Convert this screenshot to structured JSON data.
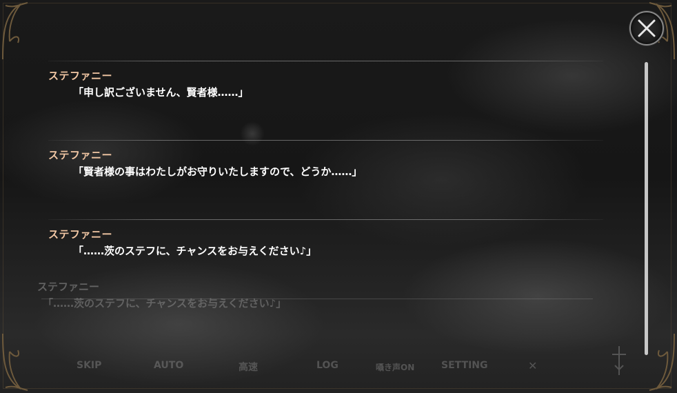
{
  "log_entries": [
    {
      "speaker": "ステファニー",
      "message": "「申し訳ございません、賢者様……」"
    },
    {
      "speaker": "ステファニー",
      "message": "「賢者様の事はわたしがお守りいたしますので、どうか……」"
    },
    {
      "speaker": "ステファニー",
      "message": "「……茨のステフに、チャンスをお与えください♪」"
    }
  ],
  "background_dialogue": {
    "speaker": "ステファニー",
    "message": "「……茨のステフに、チャンスをお与えください♪」"
  },
  "menu": {
    "skip": "SKIP",
    "auto": "AUTO",
    "fast": "高速",
    "log": "LOG",
    "voice": "囁き声ON",
    "setting": "SETTING",
    "close": "✕"
  },
  "colors": {
    "speaker": "#f2c7a4",
    "message": "#ffffff",
    "frame": "#6e5a3c"
  },
  "icons": [
    "close-icon",
    "sword-icon",
    "ornate-corner"
  ]
}
